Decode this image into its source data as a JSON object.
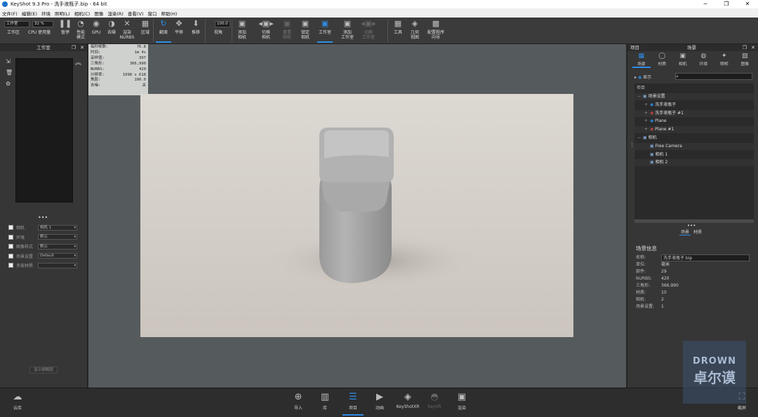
{
  "window": {
    "title": "KeyShot 9.3 Pro  - 洗手液瓶子.bip  - 64 bit",
    "btn_min": "─",
    "btn_max": "❐",
    "btn_close": "✕"
  },
  "menu": [
    "文件(F)",
    "编辑(E)",
    "环境",
    "照明(L)",
    "相机(C)",
    "图像",
    "渲染(R)",
    "查看(V)",
    "窗口",
    "帮助(H)"
  ],
  "toolbar": {
    "workspace_select": "工作室",
    "cpu_value": "32 %",
    "fov_value": "100.0",
    "buttons": [
      {
        "id": "workspace",
        "label": "工作区",
        "icon": "▭"
      },
      {
        "id": "cpu",
        "label": "CPU 使用量",
        "icon": "▥"
      },
      {
        "id": "pause",
        "label": "暂停",
        "icon": "❚❚"
      },
      {
        "id": "perf",
        "label": "性能\n模式",
        "icon": "◔"
      },
      {
        "id": "gpu",
        "label": "GPU",
        "icon": "◉"
      },
      {
        "id": "denoise",
        "label": "去噪",
        "icon": "◑"
      },
      {
        "id": "nurbs",
        "label": "渲染\nNURBS",
        "icon": "✕"
      },
      {
        "id": "region",
        "label": "区域",
        "icon": "▦"
      },
      {
        "id": "tumble",
        "label": "翻滚",
        "icon": "↻"
      },
      {
        "id": "pan",
        "label": "平移",
        "icon": "✥"
      },
      {
        "id": "dolly",
        "label": "推移",
        "icon": "⬇"
      },
      {
        "id": "fov",
        "label": "视角",
        "icon": "▤"
      },
      {
        "id": "addcam",
        "label": "添加\n相机",
        "icon": "▣"
      },
      {
        "id": "switchcam",
        "label": "切换\n相机",
        "icon": "◂▣▸"
      },
      {
        "id": "resetcam",
        "label": "重置\n相机",
        "icon": "▣"
      },
      {
        "id": "lockcam",
        "label": "锁定\n相机",
        "icon": "▣"
      },
      {
        "id": "studio",
        "label": "工作室",
        "icon": "▣"
      },
      {
        "id": "addstudio",
        "label": "添加\n工作室",
        "icon": "▣"
      },
      {
        "id": "switchstudio",
        "label": "切换\n工作室",
        "icon": "◂▣▸"
      },
      {
        "id": "tools",
        "label": "工具",
        "icon": "▦"
      },
      {
        "id": "geometry",
        "label": "几何\n视图",
        "icon": "◈"
      },
      {
        "id": "configurator",
        "label": "配置程序\n向导",
        "icon": "▩"
      }
    ]
  },
  "left_panel": {
    "title": "工作室",
    "rows": [
      {
        "label": "相机",
        "value": "相机 1"
      },
      {
        "label": "环境",
        "value": "默认"
      },
      {
        "label": "图像样式",
        "value": "默认"
      },
      {
        "label": "场景设置",
        "value": "Default"
      },
      {
        "label": "多层材质",
        "value": ""
      }
    ],
    "thumb_btn": "显示缩略图"
  },
  "hud": [
    {
      "k": "每秒帧数:",
      "v": "76.8"
    },
    {
      "k": "时间:",
      "v": "1m 4s"
    },
    {
      "k": "采样值:",
      "v": "397"
    },
    {
      "k": "三角形:",
      "v": "366,990"
    },
    {
      "k": "NURBS:",
      "v": "420"
    },
    {
      "k": "分辨率:",
      "v": "1098 x 618"
    },
    {
      "k": "焦距:",
      "v": "100.0"
    },
    {
      "k": "去噪:",
      "v": "关"
    }
  ],
  "right_panel": {
    "left_title": "项目",
    "title": "场景",
    "tabs": [
      {
        "label": "场景",
        "icon": "▦"
      },
      {
        "label": "材质",
        "icon": "◯"
      },
      {
        "label": "相机",
        "icon": "▣"
      },
      {
        "label": "环境",
        "icon": "◍"
      },
      {
        "label": "照明",
        "icon": "✦"
      },
      {
        "label": "图像",
        "icon": "▨"
      }
    ],
    "show_label": "显示",
    "tree_header": "项目",
    "tree": [
      {
        "text": "场景设置",
        "indent": 0,
        "prefix": "−"
      },
      {
        "text": "洗手液瓶子",
        "indent": 1,
        "prefix": "+"
      },
      {
        "text": "洗手液瓶子 #1",
        "indent": 1,
        "prefix": "+"
      },
      {
        "text": "Plane",
        "indent": 1,
        "prefix": "+"
      },
      {
        "text": "Plane #1",
        "indent": 1,
        "prefix": "+"
      },
      {
        "text": "相机",
        "indent": 0,
        "prefix": "−"
      },
      {
        "text": "Free Camera",
        "indent": 1,
        "prefix": ""
      },
      {
        "text": "相机 1",
        "indent": 1,
        "prefix": ""
      },
      {
        "text": "相机 2",
        "indent": 1,
        "prefix": ""
      }
    ],
    "subtabs": [
      "场景",
      "材质"
    ],
    "info_title": "场景信息",
    "info": [
      {
        "k": "名称:",
        "v": "洗手液瓶子.bip"
      },
      {
        "k": "单位:",
        "v": "毫米"
      },
      {
        "k": "部件:",
        "v": "29"
      },
      {
        "k": "NURBS:",
        "v": "420"
      },
      {
        "k": "三角形:",
        "v": "366,990"
      },
      {
        "k": "材质:",
        "v": "10"
      },
      {
        "k": "相机:",
        "v": "2"
      },
      {
        "k": "场景设置:",
        "v": "1"
      }
    ]
  },
  "bottom": {
    "buttons": [
      {
        "label": "导入",
        "icon": "⊕"
      },
      {
        "label": "库",
        "icon": "▥"
      },
      {
        "label": "项目",
        "icon": "☰"
      },
      {
        "label": "动画",
        "icon": "▶"
      },
      {
        "label": "KeyShotXR",
        "icon": "◈"
      },
      {
        "label": "KeyVR",
        "icon": "◓"
      },
      {
        "label": "渲染",
        "icon": "▣"
      }
    ],
    "cloud": "云库",
    "screenshot": "截屏"
  },
  "watermark": {
    "line1": "DROWN",
    "line2": "卓尔谟"
  }
}
